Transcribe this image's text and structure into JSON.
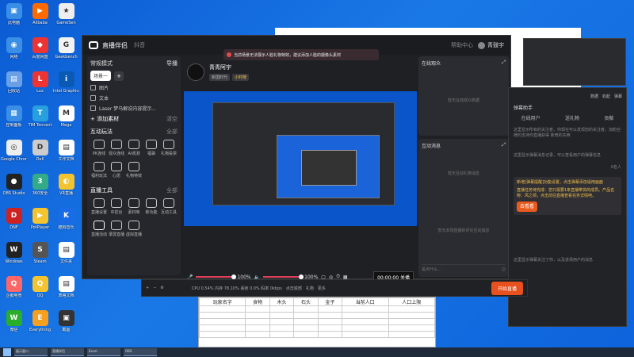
{
  "desktop_icons": [
    {
      "label": "此电脑",
      "color": "#3a8ee6",
      "glyph": "▣"
    },
    {
      "label": "Alibaba",
      "color": "#ff6a00",
      "glyph": "▶"
    },
    {
      "label": "GameSen",
      "color": "#eee",
      "glyph": "★"
    },
    {
      "label": "网络",
      "color": "#3a8ee6",
      "glyph": "◉"
    },
    {
      "label": "百度网盘",
      "color": "#e33",
      "glyph": "◆"
    },
    {
      "label": "Geekbench",
      "color": "#f3f3f3",
      "glyph": "G"
    },
    {
      "label": "回收站",
      "color": "#6aa0e6",
      "glyph": "▤"
    },
    {
      "label": "Lux",
      "color": "#e33",
      "glyph": "L"
    },
    {
      "label": "Intel Graphics",
      "color": "#0a5ab5",
      "glyph": "i"
    },
    {
      "label": "控制面板",
      "color": "#3a8ee6",
      "glyph": "▦"
    },
    {
      "label": "TIM Tencent",
      "color": "#28a0e0",
      "glyph": "T"
    },
    {
      "label": "Mega",
      "color": "#fff",
      "glyph": "M"
    },
    {
      "label": "Google Chrome",
      "color": "#eee",
      "glyph": "◎"
    },
    {
      "label": "Dell",
      "color": "#ccc",
      "glyph": "D"
    },
    {
      "label": "工作文档",
      "color": "#fff",
      "glyph": "▤"
    },
    {
      "label": "OBS Studio",
      "color": "#222",
      "glyph": "●"
    },
    {
      "label": "360安全",
      "color": "#3a8",
      "glyph": "3"
    },
    {
      "label": "VR直播",
      "color": "#f4c430",
      "glyph": "◐"
    },
    {
      "label": "DNF",
      "color": "#c22",
      "glyph": "D"
    },
    {
      "label": "PotPlayer",
      "color": "#f4c430",
      "glyph": "▶"
    },
    {
      "label": "酷狗音乐",
      "color": "#1a6be6",
      "glyph": "K"
    },
    {
      "label": "Windows",
      "color": "#222",
      "glyph": "W"
    },
    {
      "label": "Steam",
      "color": "#555",
      "glyph": "S"
    },
    {
      "label": "文件夹",
      "color": "#fff",
      "glyph": "▤"
    },
    {
      "label": "企鹅电竞",
      "color": "#f66",
      "glyph": "Q"
    },
    {
      "label": "QQ",
      "color": "#f4c430",
      "glyph": "Q"
    },
    {
      "label": "表格文档",
      "color": "#fff",
      "glyph": "▤"
    },
    {
      "label": "微信",
      "color": "#2aae2a",
      "glyph": "W"
    },
    {
      "label": "Everything",
      "color": "#f7a020",
      "glyph": "E"
    },
    {
      "label": "截图",
      "color": "#333",
      "glyph": "▣"
    }
  ],
  "app": {
    "title": "直播伴侣",
    "subtitle": "抖音",
    "mode_label": "常规模式",
    "landscape_label": "导播",
    "scene_chip": "场景一",
    "sources": [
      "图片",
      "文本",
      "Laser 梦马解说内容提示..."
    ],
    "add_source": "添加素材",
    "clear": "清空",
    "interact_title": "互动玩法",
    "interact_all": "全部",
    "interact_tools": [
      "PK连线",
      "观众连线",
      "AI观测",
      "福袋",
      "礼物投票",
      "福利玩法",
      "心愿",
      "礼物特效"
    ],
    "live_tools_title": "直播工具",
    "live_tools_all": "全部",
    "live_tools": [
      "直播设置",
      "中控台",
      "素材库",
      "新功能",
      "互动工具",
      "直播活动",
      "录屏直播",
      "虚拟直播"
    ],
    "streamer_name": "青青阿宇",
    "tag_age": "新国时代",
    "tag_level": "小时榜",
    "user_name": "青鼓宇",
    "help": "帮助中心",
    "mic_percent": "100%",
    "speaker_percent": "100%",
    "mic_level": 1.0,
    "speaker_level": 1.0,
    "timer": "00:00:00",
    "close": "关播",
    "audience_title": "在线观众",
    "audience_empty": "暂无在线观众数据",
    "gift_title": "互动消息",
    "gift_empty": "暂无互动礼物消息",
    "gift_empty2": "暂无本场直播的评论互动消息",
    "chat_placeholder": "说点什么..."
  },
  "banner": {
    "text": "当前场景无法展示人脸礼物特效，建议添加人脸的摄像头素材"
  },
  "helper": {
    "top_items": [
      "数据",
      "收起",
      "弹幕"
    ],
    "title": "弹幕助手",
    "tabs": [
      "在线用户",
      "送礼物",
      "贡献"
    ],
    "text1": "这里显示所有的关注者，你现在可以发现您的关注者，加粉丝牌的支持你直播获得 新奇的东西",
    "text2": "这里显示弹幕消息记录，可以查看用户的弹幕信息",
    "online_note": "0名人",
    "msg": "新增[弹幕提醒]功能设置，点击弹幕添加适用画面",
    "task": "直播任务待完成：您只需要1条直播带货的成员。产品名称：风之领，点击前往直播查看任务详情吧。",
    "go_btn": "去看看",
    "footer": "这里显示弹幕关注了你，以及进场用户的消息"
  },
  "bottom_bar": {
    "stats": "CPU 0.54%  内存 78.10%  丢帧 0.0%  码率 0kbps",
    "hint": "点击底部",
    "start_live": "开始直播",
    "gift": "礼物",
    "more": "更多"
  },
  "sheet": {
    "headers": [
      "玩家名字",
      "食物",
      "木头",
      "石头",
      "金子",
      "当前人口",
      "人口上限"
    ]
  },
  "taskbar": [
    "展示窗口",
    "直播伴侣",
    "Excel",
    "OBS"
  ]
}
